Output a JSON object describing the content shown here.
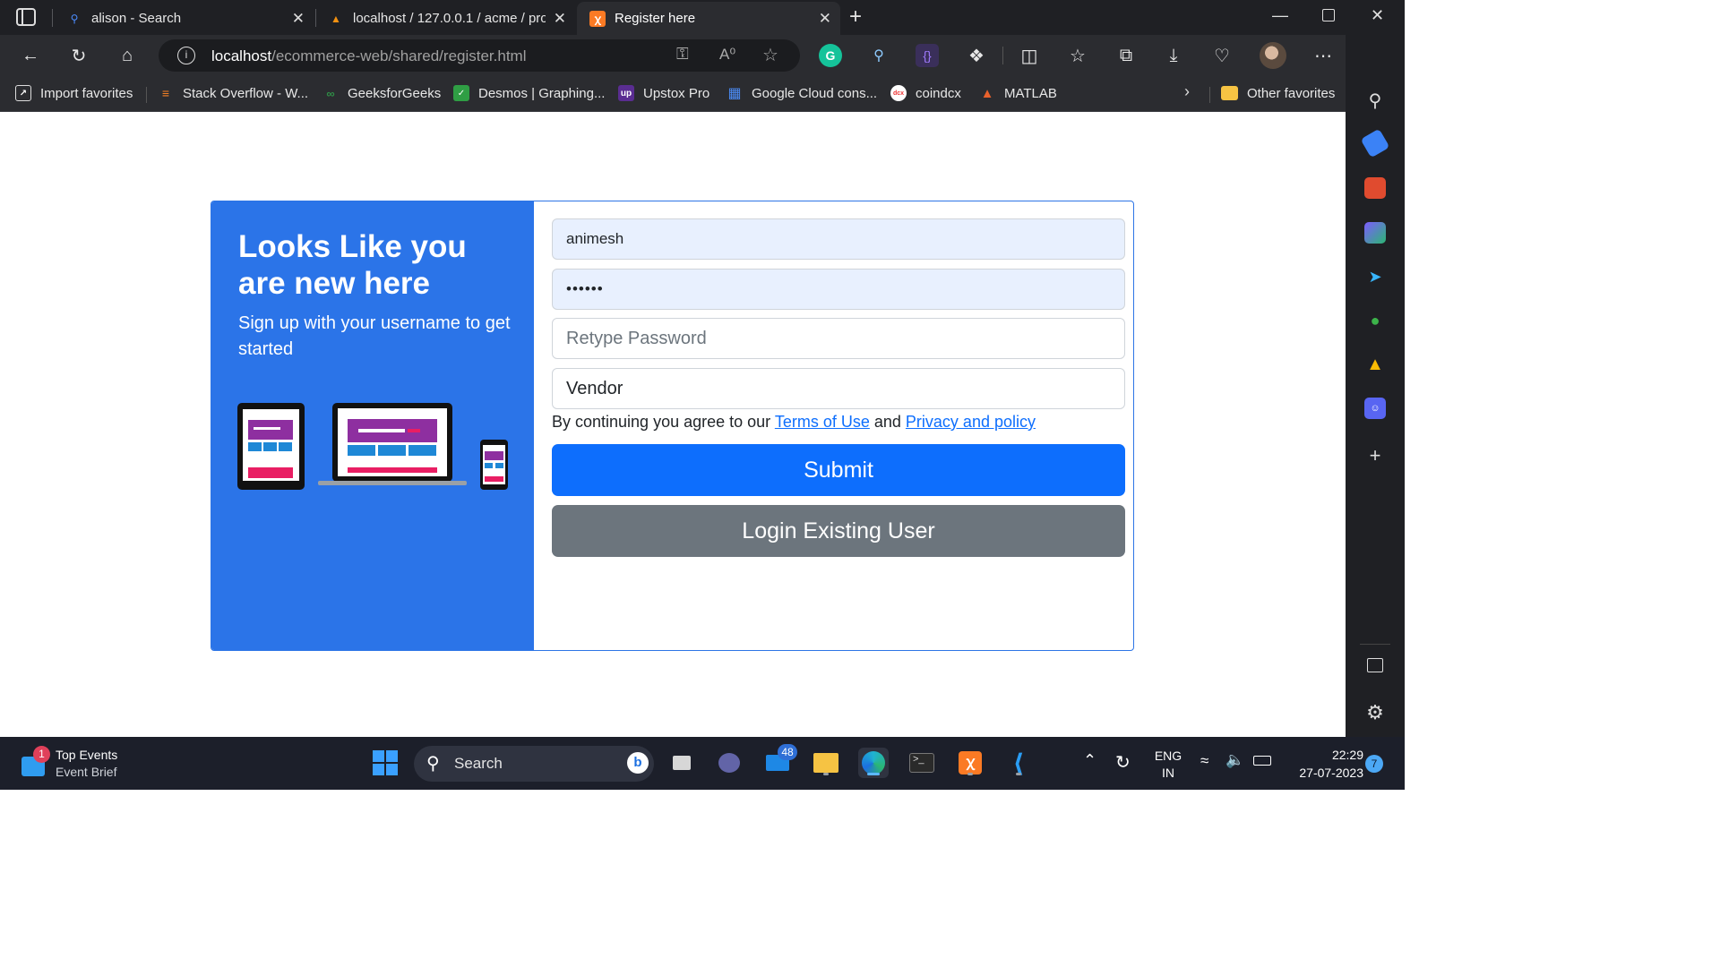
{
  "browser": {
    "tabs": [
      {
        "title": "alison - Search",
        "icon": "search-icon",
        "active": false
      },
      {
        "title": "localhost / 127.0.0.1 / acme / pro",
        "icon": "phpmyadmin-icon",
        "active": false
      },
      {
        "title": "Register here",
        "icon": "xampp-icon",
        "active": true
      }
    ],
    "address": {
      "host": "localhost",
      "path": "/ecommerce-web/shared/register.html"
    },
    "favorites": [
      {
        "label": "Import favorites",
        "icon": "import-icon"
      },
      {
        "label": "Stack Overflow - W...",
        "icon": "stackoverflow-icon"
      },
      {
        "label": "GeeksforGeeks",
        "icon": "gfg-icon"
      },
      {
        "label": "Desmos | Graphing...",
        "icon": "desmos-icon"
      },
      {
        "label": "Upstox Pro",
        "icon": "upstox-icon"
      },
      {
        "label": "Google Cloud cons...",
        "icon": "google-cloud-icon"
      },
      {
        "label": "coindcx",
        "icon": "coindcx-icon"
      },
      {
        "label": "MATLAB",
        "icon": "matlab-icon"
      }
    ],
    "other_favorites": "Other favorites",
    "colors": {
      "frame": "#1f2024",
      "toolbar": "#2b2c30"
    }
  },
  "page": {
    "heading": "Looks Like you are new here",
    "subheading": "Sign up with your username to get started",
    "form": {
      "username_value": "animesh",
      "password_value": "••••••",
      "retype_placeholder": "Retype Password",
      "role_value": "Vendor",
      "terms_prefix": "By continuing you agree to our ",
      "terms_link": "Terms of Use",
      "terms_and": " and ",
      "privacy_link": "Privacy and policy",
      "submit_label": "Submit",
      "login_label": "Login Existing User"
    },
    "colors": {
      "panel": "#2b74e8",
      "submit": "#0d6efd",
      "login": "#6c757d",
      "input_filled": "#e8f0fe"
    }
  },
  "taskbar": {
    "widget_title": "Top Events",
    "widget_subtitle": "Event Brief",
    "widget_badge": "1",
    "search_label": "Search",
    "mail_badge": "48",
    "lang_top": "ENG",
    "lang_bottom": "IN",
    "time": "22:29",
    "date": "27-07-2023",
    "notification_count": "7"
  }
}
